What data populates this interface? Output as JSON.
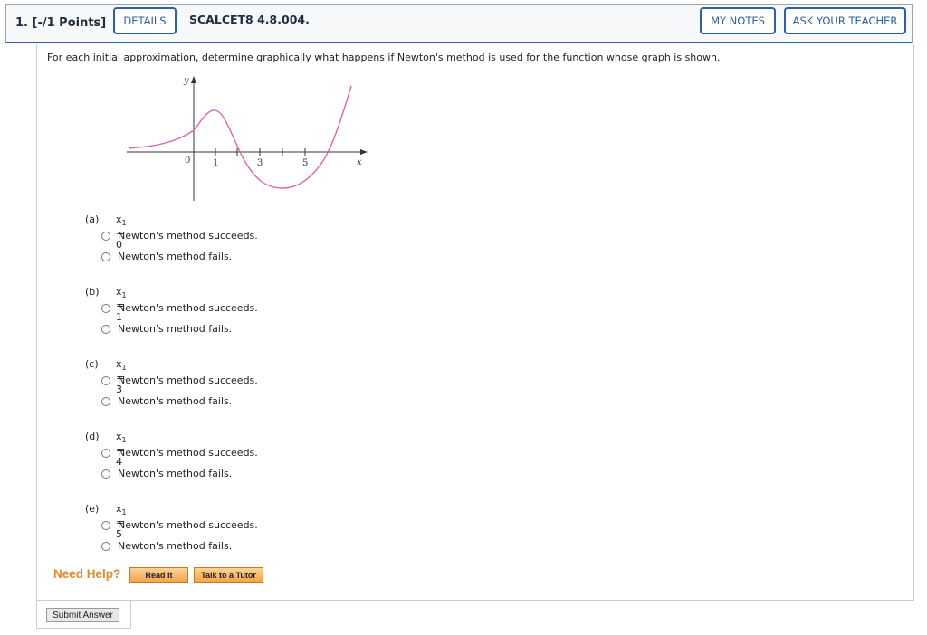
{
  "header": {
    "points": "1.  [-/1 Points]",
    "details_label": "DETAILS",
    "problem_code": "SCALCET8 4.8.004.",
    "my_notes_label": "MY NOTES",
    "ask_teacher_label": "ASK YOUR TEACHER"
  },
  "prompt": "For each initial approximation, determine graphically what happens if Newton's method is used for the function whose graph is shown.",
  "graph": {
    "y_label": "y",
    "x_label": "x",
    "origin_label": "0",
    "tick_labels": [
      "1",
      "3",
      "5"
    ],
    "curve_color": "#d66aa8"
  },
  "parts": [
    {
      "label": "(a)",
      "x_var": "x",
      "x_sub": "1",
      "x_value": " = 0",
      "options": [
        "Newton's method succeeds.",
        "Newton's method fails."
      ]
    },
    {
      "label": "(b)",
      "x_var": "x",
      "x_sub": "1",
      "x_value": " = 1",
      "options": [
        "Newton's method succeeds.",
        "Newton's method fails."
      ]
    },
    {
      "label": "(c)",
      "x_var": "x",
      "x_sub": "1",
      "x_value": " = 3",
      "options": [
        "Newton's method succeeds.",
        "Newton's method fails."
      ]
    },
    {
      "label": "(d)",
      "x_var": "x",
      "x_sub": "1",
      "x_value": " = 4",
      "options": [
        "Newton's method succeeds.",
        "Newton's method fails."
      ]
    },
    {
      "label": "(e)",
      "x_var": "x",
      "x_sub": "1",
      "x_value": " = 5",
      "options": [
        "Newton's method succeeds.",
        "Newton's method fails."
      ]
    }
  ],
  "help": {
    "need_help": "Need Help?",
    "read_it": "Read It",
    "talk_to_tutor": "Talk to a Tutor"
  },
  "submit_label": "Submit Answer",
  "colors": {
    "accent": "#2f5f9e",
    "help_orange": "#e0892a"
  }
}
